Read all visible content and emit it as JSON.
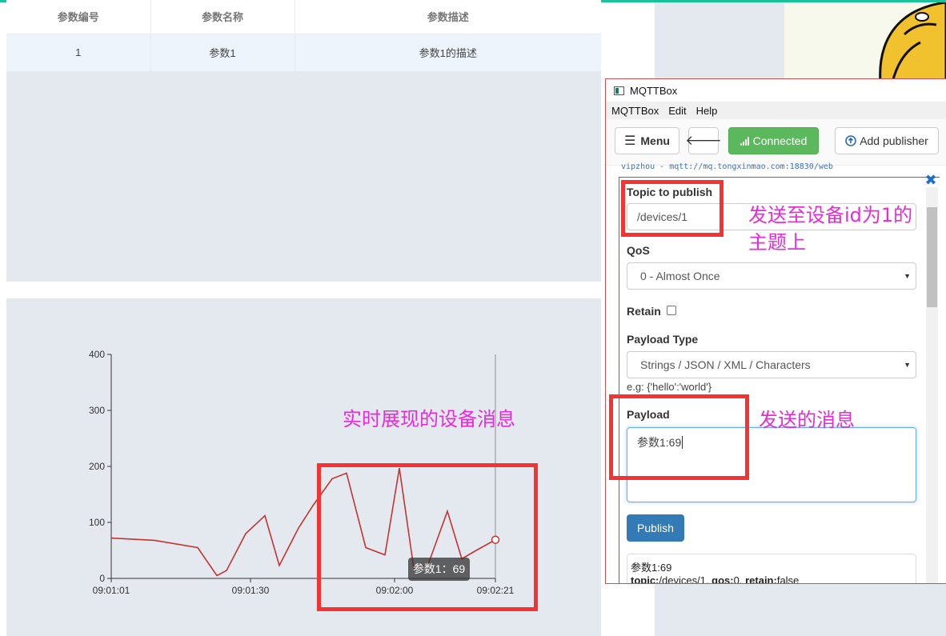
{
  "table": {
    "headers": [
      "参数编号",
      "参数名称",
      "参数描述"
    ],
    "rows": [
      [
        "1",
        "参数1",
        "参数1的描述"
      ]
    ]
  },
  "chart_data": {
    "type": "line",
    "series": [
      {
        "x": [
          "09:01:01",
          "09:01:10",
          "09:01:19",
          "09:01:23",
          "09:01:25",
          "09:01:29",
          "09:01:33",
          "09:01:36",
          "09:01:40",
          "09:01:43",
          "09:01:47",
          "09:01:50",
          "09:01:54",
          "09:01:58",
          "09:02:01",
          "09:02:04",
          "09:02:07",
          "09:02:11",
          "09:02:14",
          "09:02:17",
          "09:02:21"
        ],
        "values": [
          72,
          68,
          55,
          5,
          14,
          80,
          112,
          23,
          90,
          130,
          178,
          188,
          55,
          42,
          197,
          18,
          25,
          120,
          35,
          50,
          69
        ]
      }
    ],
    "x_ticks": [
      "09:01:01",
      "09:01:30",
      "09:02:00",
      "09:02:21"
    ],
    "y_ticks": [
      0,
      100,
      200,
      300,
      400
    ],
    "ylim": [
      0,
      400
    ],
    "line_color": "#c23531",
    "tooltip": "参数1：69"
  },
  "annotations": {
    "chart_note": "实时展现的设备消息",
    "topic_note_line1": "发送至设备id为1的",
    "topic_note_line2": "主题上",
    "payload_note": "发送的消息"
  },
  "window": {
    "title": "MQTTBox",
    "menu": [
      "MQTTBox",
      "Edit",
      "Help"
    ],
    "menu_button": "Menu",
    "connected_button": "Connected",
    "add_publisher_button": "Add publisher",
    "connection_url": "vipzhou - mqtt://mq.tongxinmao.com:18830/web",
    "topic_label": "Topic to publish",
    "topic_value": "/devices/1",
    "qos_label": "QoS",
    "qos_value": "0 - Almost Once",
    "retain_label": "Retain",
    "payload_type_label": "Payload Type",
    "payload_type_value": "Strings / JSON / XML / Characters",
    "payload_hint": "e.g: {'hello':'world'}",
    "payload_label": "Payload",
    "payload_value": "参数1:69",
    "publish_button": "Publish",
    "message_text": "参数1:69",
    "message_meta_topic_label": "topic:",
    "message_meta_topic": "/devices/1",
    "message_meta_qos_label": "qos:",
    "message_meta_qos": "0",
    "message_meta_retain_label": "retain:",
    "message_meta_retain": "false"
  },
  "colors": {
    "accent_bar": "#19c39a",
    "annotation_box": "#f53333",
    "annotation_text": "#e62bd8"
  }
}
